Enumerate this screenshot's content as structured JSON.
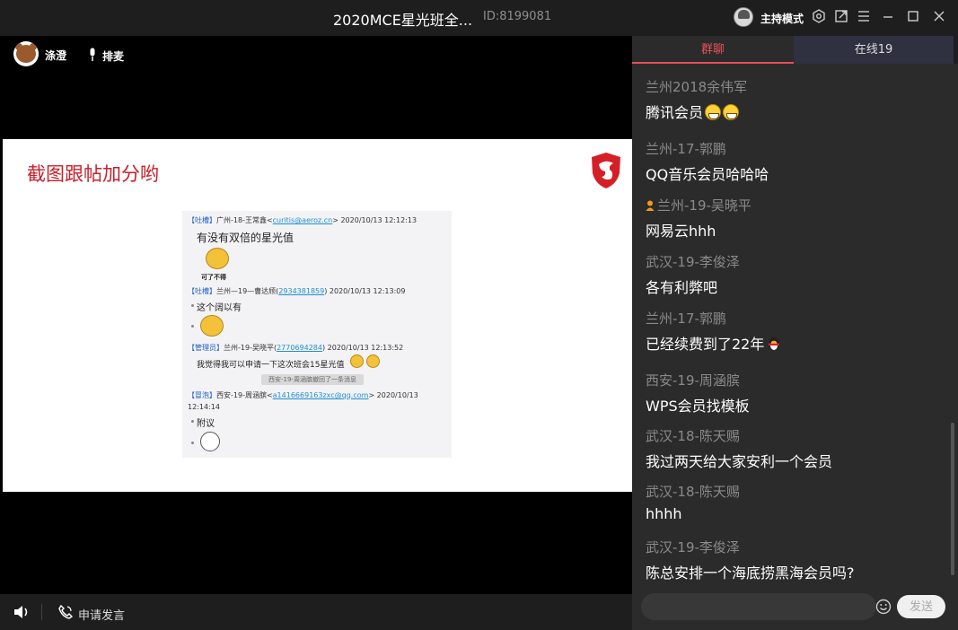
{
  "titlebar": {
    "title": "2020MCE星光班全...",
    "room_id": "ID:8199081",
    "host_mode": "主持模式"
  },
  "video": {
    "presenter_name": "涤澄",
    "queue_label": "排麦",
    "slide_title": "截图跟帖加分哟",
    "screenshot": {
      "m1_tag": "【吐槽】",
      "m1_sender": "广州-18-王常鑫<",
      "m1_email": "curitis@aeroz.cn",
      "m1_time": "> 2020/10/13 12:12:13",
      "m1_text": "有没有双倍的星光值",
      "sticker_caption": "可了不得",
      "m2_tag": "【吐槽】",
      "m2_sender": "兰州—19—曹达颀(",
      "m2_qq": "2934381859",
      "m2_time": ") 2020/10/13 12:13:09",
      "m2_text": "这个阔以有",
      "m3_tag": "【管理员】",
      "m3_sender": "兰州-19-吴晓平(",
      "m3_qq": "2770694284",
      "m3_time": ") 2020/10/13 12:13:52",
      "m3_text": "我觉得我可以申请一下这次班会15星光值",
      "recall_notice": "西安-19-周涵膑撤回了一条消息",
      "m4_tag": "【冒泡】",
      "m4_sender": "西安-19-周涵膑<",
      "m4_email": "a1416669163zxc@qq.com",
      "m4_time": "> 2020/10/13",
      "m4_time2": "12:14:14",
      "m4_text": "附议"
    }
  },
  "bottombar": {
    "apply_label": "申请发言"
  },
  "panel": {
    "tab_group": "群聊",
    "tab_online": "在线19",
    "messages": [
      {
        "sender": "兰州2018余伟军",
        "text": "腾讯会员"
      },
      {
        "sender": "兰州-17-郭鹏",
        "text": "QQ音乐会员哈哈哈"
      },
      {
        "sender": "兰州-19-吴晓平",
        "text": "网易云hhh"
      },
      {
        "sender": "武汉-19-李俊泽",
        "text": "各有利弊吧"
      },
      {
        "sender": "兰州-17-郭鹏",
        "text": "已经续费到了22年"
      },
      {
        "sender": "西安-19-周涵膑",
        "text": "WPS会员找模板"
      },
      {
        "sender": "武汉-18-陈天赐",
        "text": "我过两天给大家安利一个会员"
      },
      {
        "sender": "武汉-18-陈天赐",
        "text": "hhhh"
      },
      {
        "sender": "武汉-19-李俊泽",
        "text": "陈总安排一个海底捞黑海会员吗?"
      }
    ],
    "send_label": "发送",
    "input_value": ""
  },
  "colors": {
    "accent": "#e8515b",
    "slide_title": "#c8202a",
    "background": "#1e1e1e",
    "panel": "#2b2b2b"
  }
}
